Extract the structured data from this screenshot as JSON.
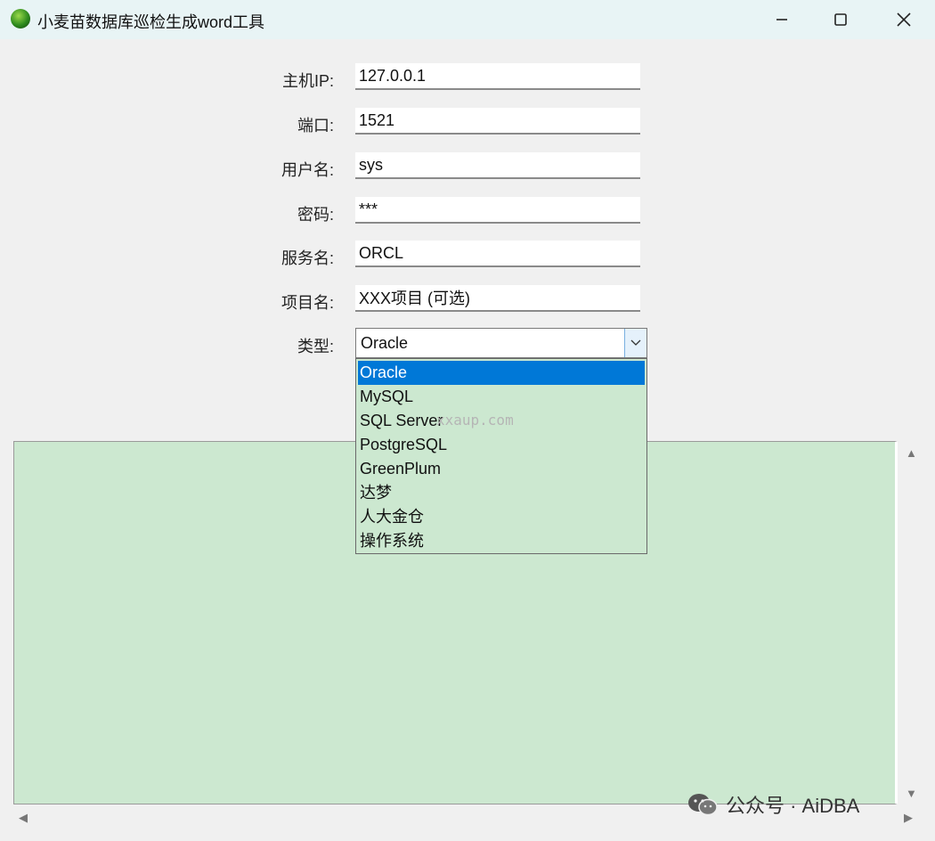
{
  "window": {
    "title": "小麦苗数据库巡检生成word工具",
    "icon": "leaf-app-icon",
    "controls": {
      "minimize": "minimize-icon",
      "maximize": "maximize-icon",
      "close": "close-icon"
    }
  },
  "form": {
    "fields": [
      {
        "label": "主机IP:",
        "value": "127.0.0.1"
      },
      {
        "label": "端口:",
        "value": "1521"
      },
      {
        "label": "用户名:",
        "value": "sys"
      },
      {
        "label": "密码:",
        "value": "***"
      },
      {
        "label": "服务名:",
        "value": "ORCL"
      },
      {
        "label": "项目名:",
        "value": "XXX项目 (可选)"
      }
    ],
    "type": {
      "label": "类型:",
      "selected": "Oracle",
      "options": [
        "Oracle",
        "MySQL",
        "SQL Server",
        "PostgreSQL",
        "GreenPlum",
        "达梦",
        "人大金仓",
        "操作系统"
      ]
    }
  },
  "overlay_watermark": "xxaup.com",
  "footer_watermark": "公众号 · AiDBA",
  "colors": {
    "title_bar": "#e8f4f5",
    "output_bg": "#cce8d0",
    "selection": "#0078d7"
  }
}
